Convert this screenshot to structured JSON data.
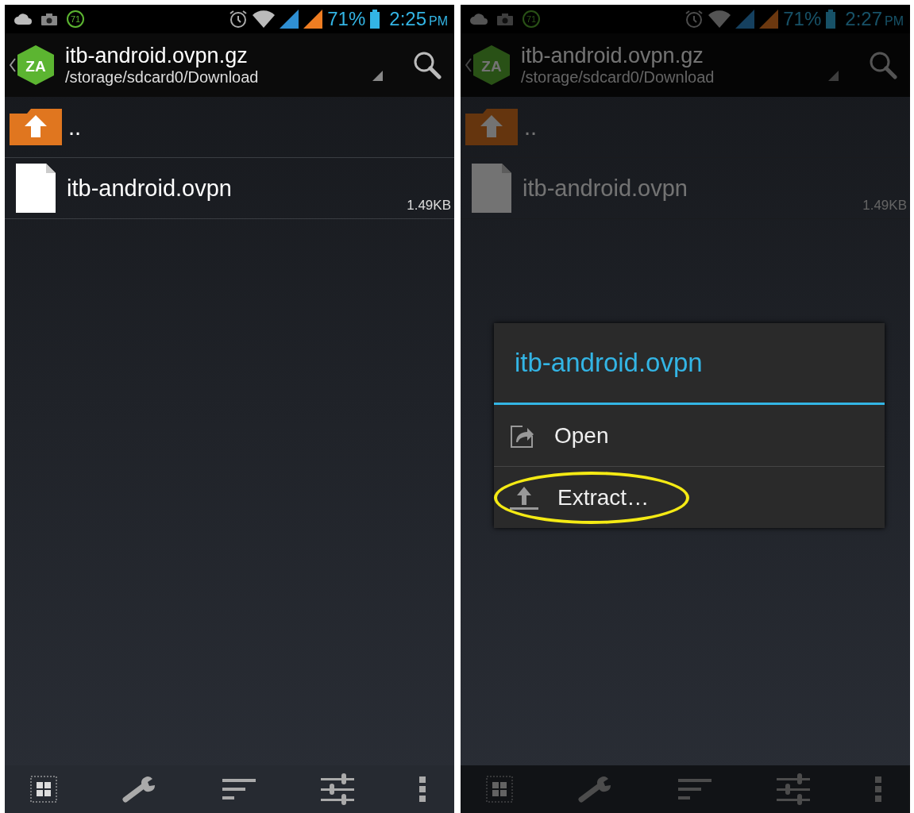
{
  "screens": [
    {
      "dimmed": false,
      "status_bar": {
        "badge": "71",
        "battery": "71%",
        "time": "2:25",
        "period": "PM"
      },
      "header": {
        "logo_text": "ZA",
        "title": "itb-android.ovpn.gz",
        "path": "/storage/sdcard0/Download"
      },
      "files": [
        {
          "kind": "parent",
          "name": ".."
        },
        {
          "kind": "file",
          "name": "itb-android.ovpn",
          "size": "1.49KB"
        }
      ]
    },
    {
      "dimmed": true,
      "status_bar": {
        "badge": "71",
        "battery": "71%",
        "time": "2:27",
        "period": "PM"
      },
      "header": {
        "logo_text": "ZA",
        "title": "itb-android.ovpn.gz",
        "path": "/storage/sdcard0/Download"
      },
      "files": [
        {
          "kind": "parent",
          "name": ".."
        },
        {
          "kind": "file",
          "name": "itb-android.ovpn",
          "size": "1.49KB"
        }
      ],
      "dialog": {
        "title": "itb-android.ovpn",
        "items": [
          {
            "kind": "open",
            "label": "Open",
            "highlighted": false
          },
          {
            "kind": "extract",
            "label": "Extract…",
            "highlighted": true
          }
        ]
      }
    }
  ]
}
